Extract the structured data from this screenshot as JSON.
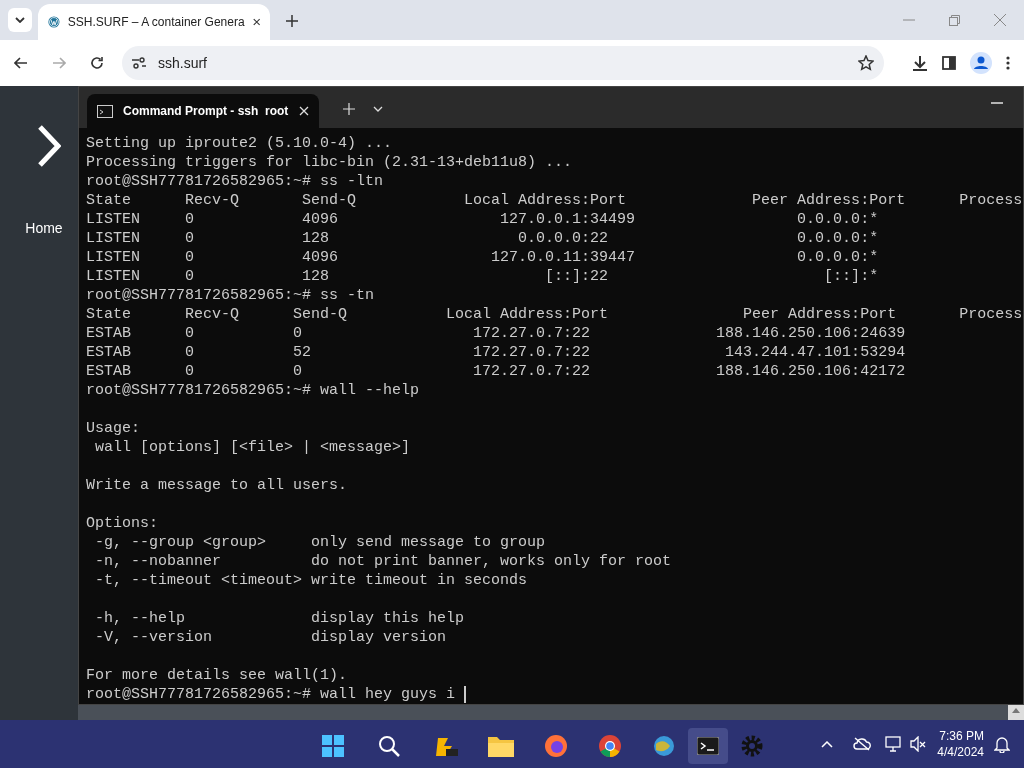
{
  "browser": {
    "tab_title": "SSH.SURF – A container Genera",
    "address": "ssh.surf"
  },
  "page": {
    "nav_label": "Home"
  },
  "terminal": {
    "tab_title": "Command Prompt - ssh  root",
    "blocks": [
      [
        "Setting up iproute2 (5.10.0-4) ...",
        "Processing triggers for libc-bin (2.31-13+deb11u8) ...",
        "root@SSH77781726582965:~# ss -ltn",
        "State      Recv-Q       Send-Q            Local Address:Port              Peer Address:Port      Process",
        "LISTEN     0            4096                  127.0.0.1:34499                  0.0.0.0:*",
        "LISTEN     0            128                     0.0.0.0:22                     0.0.0.0:*",
        "LISTEN     0            4096                 127.0.0.11:39447                  0.0.0.0:*",
        "LISTEN     0            128                        [::]:22                        [::]:*",
        "root@SSH77781726582965:~# ss -tn",
        "State      Recv-Q      Send-Q           Local Address:Port               Peer Address:Port       Process",
        "ESTAB      0           0                   172.27.0.7:22              188.146.250.106:24639",
        "ESTAB      0           52                  172.27.0.7:22               143.244.47.101:53294",
        "ESTAB      0           0                   172.27.0.7:22              188.146.250.106:42172",
        "root@SSH77781726582965:~# wall --help"
      ],
      [
        "Usage:",
        " wall [options] [<file> | <message>]"
      ],
      [
        "Write a message to all users."
      ],
      [
        "Options:",
        " -g, --group <group>     only send message to group",
        " -n, --nobanner          do not print banner, works only for root",
        " -t, --timeout <timeout> write timeout in seconds"
      ],
      [
        " -h, --help              display this help",
        " -V, --version           display version"
      ],
      [
        "For more details see wall(1).",
        "root@SSH77781726582965:~# wall hey guys i "
      ]
    ]
  },
  "taskbar": {
    "time": "7:36 PM",
    "date": "4/4/2024"
  }
}
